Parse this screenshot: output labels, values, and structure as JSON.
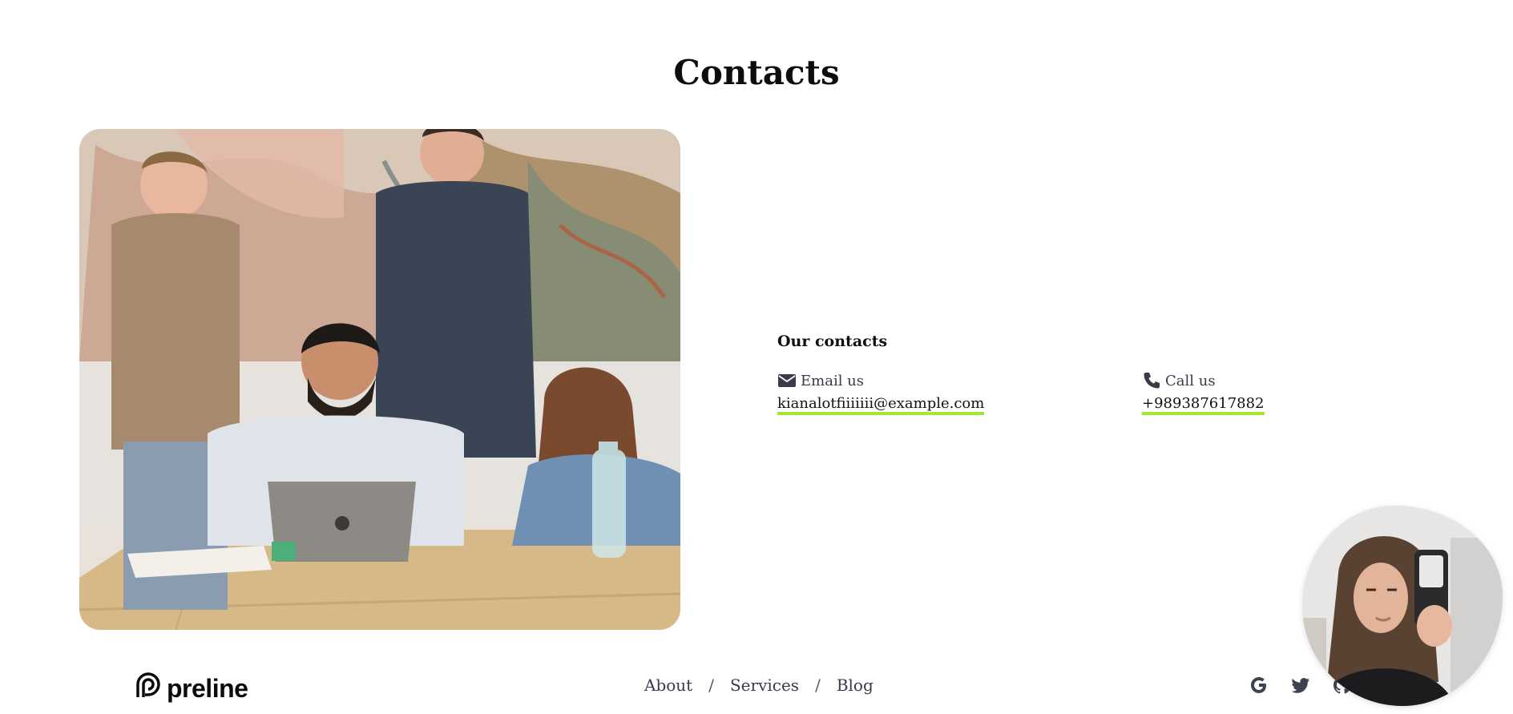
{
  "page": {
    "title": "Contacts"
  },
  "contacts": {
    "heading": "Our contacts",
    "email": {
      "label": "Email us",
      "value": "kianalotfiiiiiii@example.com",
      "icon": "envelope-icon"
    },
    "phone": {
      "label": "Call us",
      "value": "+989387617882",
      "icon": "phone-icon"
    },
    "underline_color": "#a3e635"
  },
  "footer": {
    "logo_text": "preline",
    "nav": [
      {
        "label": "About"
      },
      {
        "label": "Services"
      },
      {
        "label": "Blog"
      }
    ],
    "separator": "/",
    "social": [
      "google-icon",
      "twitter-icon",
      "github-icon"
    ]
  },
  "images": {
    "team_photo": "team-photo",
    "video_bubble": "webcam-bubble"
  }
}
